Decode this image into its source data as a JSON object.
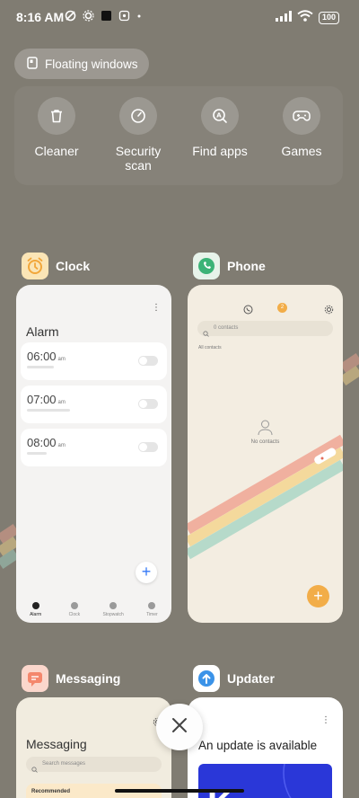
{
  "status_bar": {
    "time": "8:16 AM",
    "battery": "100"
  },
  "floating_windows": {
    "label": "Floating windows"
  },
  "quick_actions": [
    {
      "label": "Cleaner",
      "icon": "trash-icon"
    },
    {
      "label": "Security scan",
      "icon": "gauge-icon"
    },
    {
      "label": "Find apps",
      "icon": "find-apps-icon"
    },
    {
      "label": "Games",
      "icon": "gamepad-icon"
    }
  ],
  "apps": {
    "clock": {
      "name": "Clock",
      "title": "Alarm",
      "alarms": [
        {
          "time": "06:00",
          "ampm": "am"
        },
        {
          "time": "07:00",
          "ampm": "am"
        },
        {
          "time": "08:00",
          "ampm": "am"
        }
      ],
      "fab": "+",
      "tabs": [
        "Alarm",
        "Clock",
        "Stopwatch",
        "Timer"
      ]
    },
    "phone": {
      "name": "Phone",
      "badge": "2",
      "search_placeholder": "0 contacts",
      "all_contacts": "All contacts",
      "no_contacts": "No contacts",
      "fab": "+"
    },
    "messaging": {
      "name": "Messaging",
      "title": "Messaging",
      "search_placeholder": "Search messages",
      "recommended": "Recommended"
    },
    "updater": {
      "name": "Updater",
      "title": "An update is available",
      "banner_text": "K"
    }
  },
  "colors": {
    "background": "#807c72",
    "phone_accent": "#f2ad48",
    "clock_accent": "#3479f6",
    "updater_banner": "#2a37d8"
  }
}
